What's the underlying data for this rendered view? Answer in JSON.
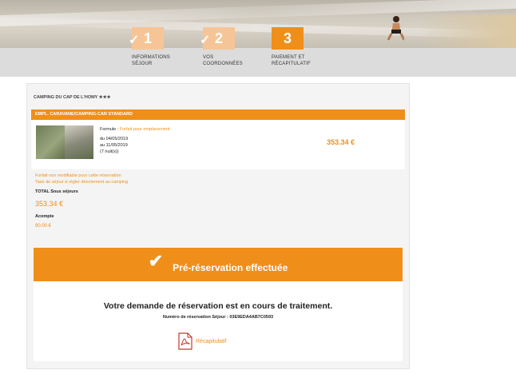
{
  "steps": [
    {
      "number": "1",
      "label": "Informations séjour",
      "state": "done"
    },
    {
      "number": "2",
      "label": "Vos coordonnées",
      "state": "done"
    },
    {
      "number": "3",
      "label": "Paiement et récapitulatif",
      "state": "active"
    }
  ],
  "colors": {
    "accent": "#ef8f1a",
    "accent_light": "#f6c597",
    "panel_bg": "#f4f4f4"
  },
  "reservation": {
    "camping_name": "CAMPING DU CAP DE L'HOMY ★★★",
    "offer_title": "EMPL. CARAVANE/CAMPING-CAR STANDARD",
    "formula_label": "Formule :",
    "formula_value": "Forfait pour emplacement",
    "date_from": "du 04/05/2019",
    "date_to": "au 11/05/2019",
    "nights": "(7 nuit(s))",
    "price": "353.34 €",
    "note_line1": "Forfait non modifiable pour cette réservation",
    "note_line2": "Taxe de séjour à régler directement au camping",
    "total_label": "TOTAL Sous séjours",
    "total_value": "353.34 €",
    "deposit_label": "Acompte",
    "deposit_value": "90.00 €"
  },
  "confirmation": {
    "banner_text": "Pré-réservation effectuée",
    "processing_text": "Votre demande de réservation est en cours de traitement.",
    "number_label": "Numéro de réservation Séjour : 03E9EDA4AB7C0593",
    "recap_label": "Récapitulatif",
    "icons": [
      "check-icon",
      "pdf-icon"
    ]
  }
}
